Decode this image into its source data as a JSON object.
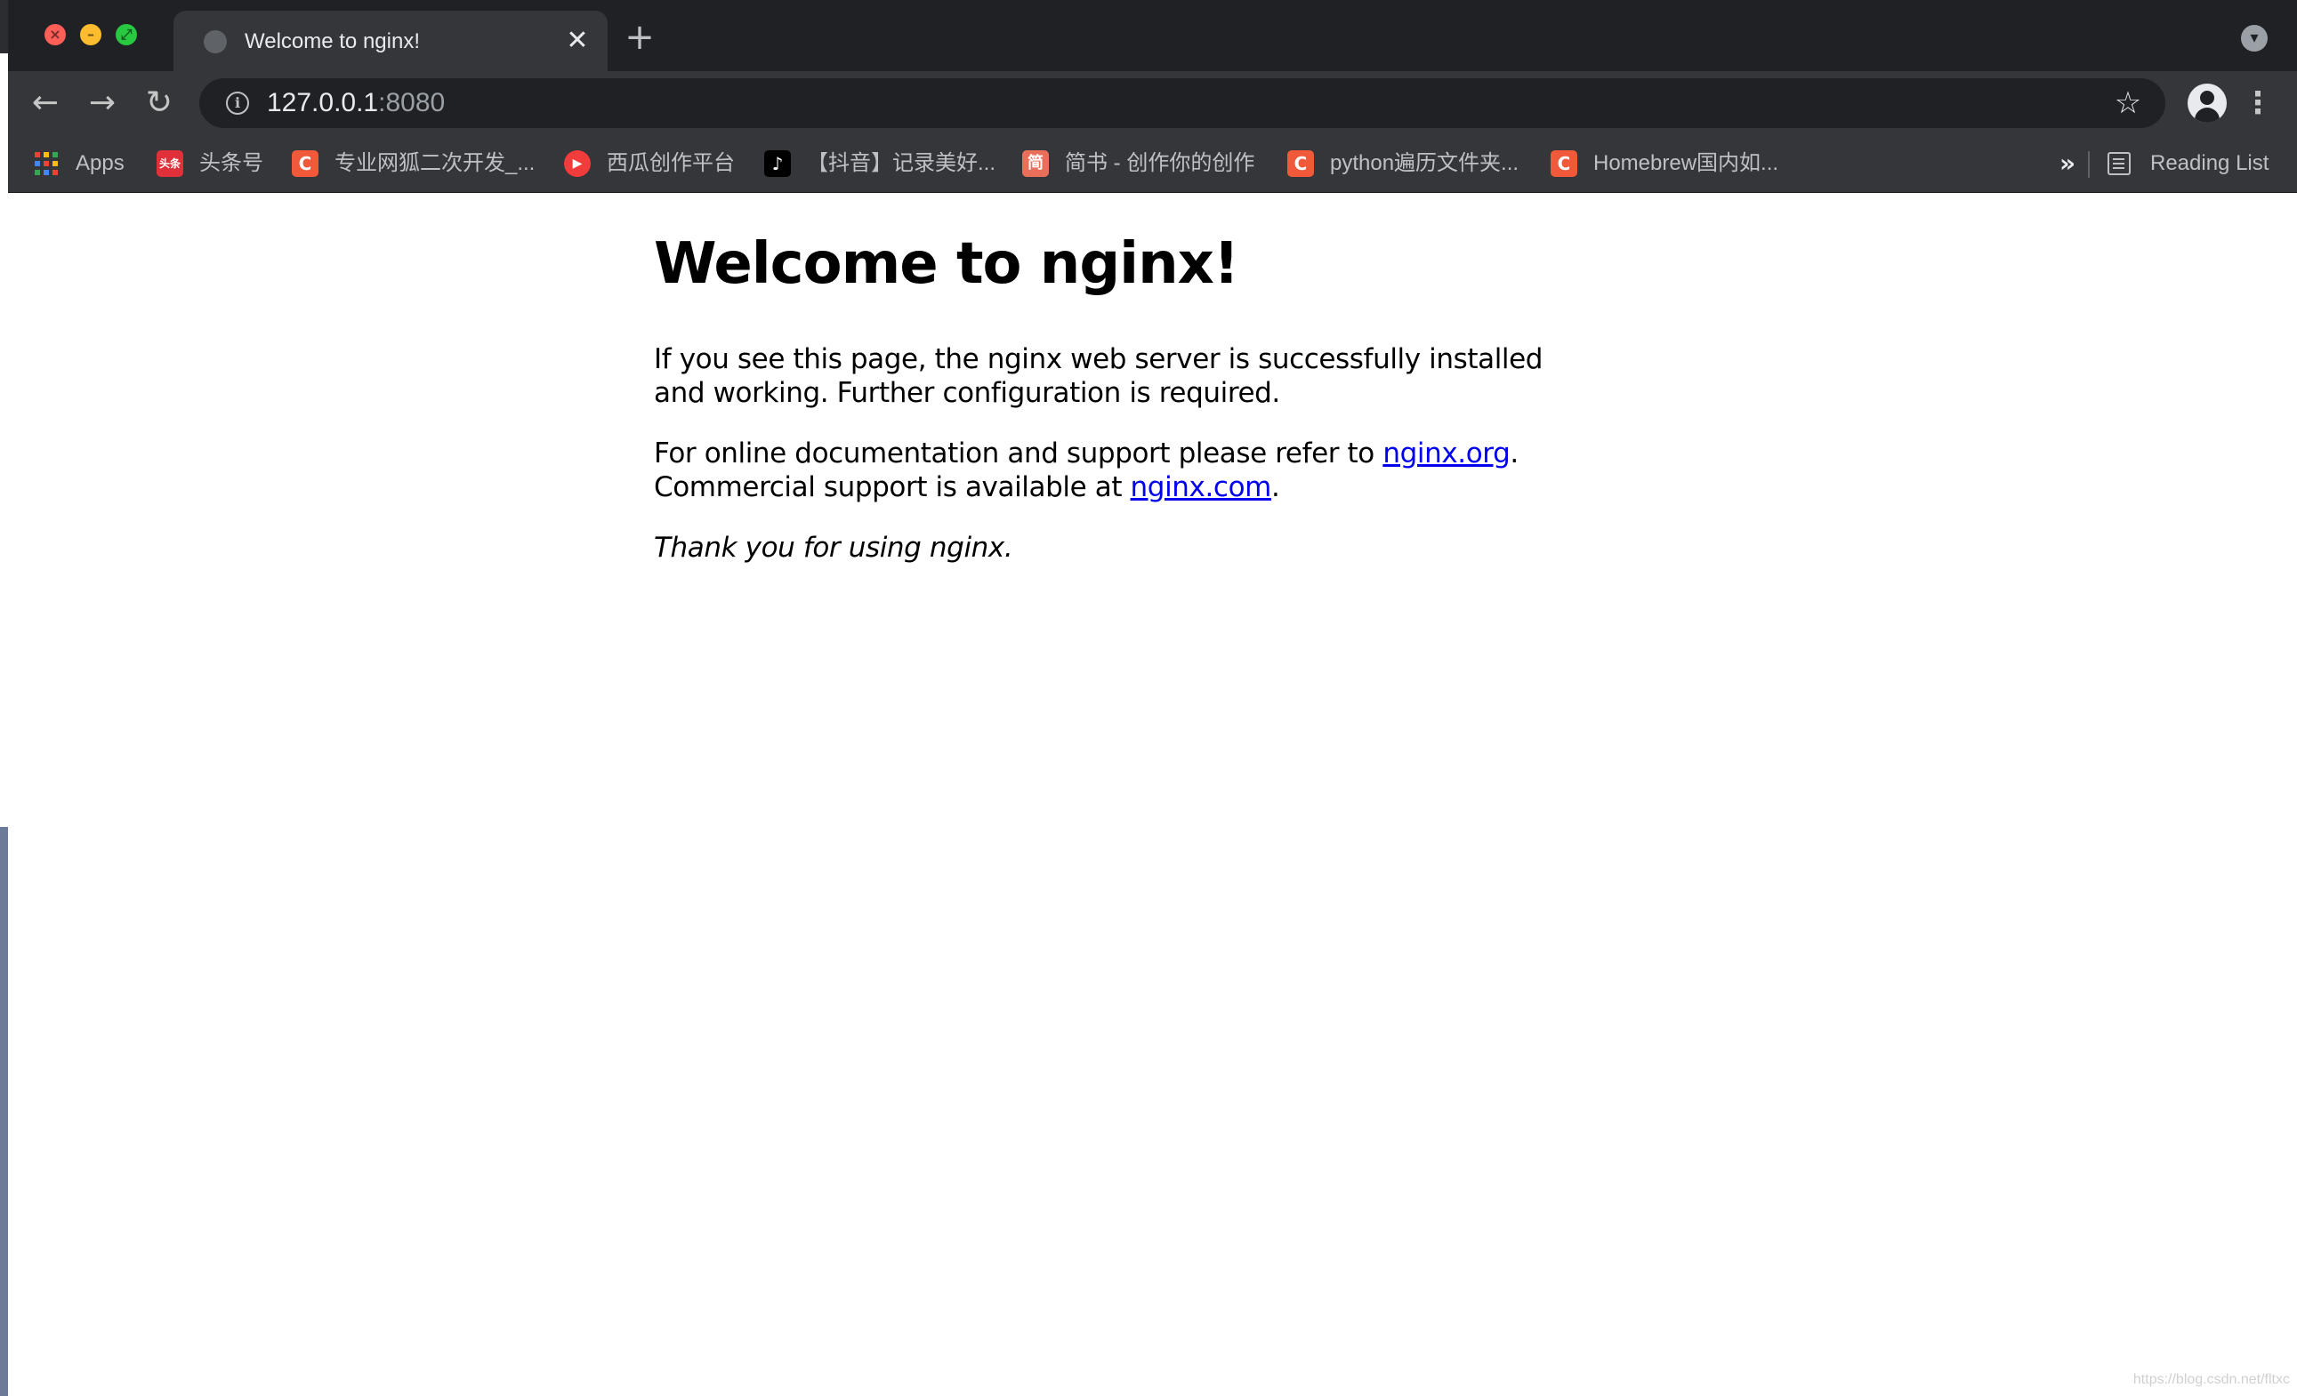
{
  "tab": {
    "title": "Welcome to nginx!",
    "close_glyph": "✕",
    "new_tab_glyph": "+"
  },
  "toolbar": {
    "back_glyph": "←",
    "forward_glyph": "→",
    "reload_glyph": "↻",
    "url_host": "127.0.0.1",
    "url_port": ":8080",
    "star_glyph": "☆",
    "menu_glyph": "⋮"
  },
  "bookmarks": {
    "items": [
      {
        "label": "Apps"
      },
      {
        "label": "头条号",
        "icon_text": "头条",
        "icon_color": "#e0313a"
      },
      {
        "label": "专业网狐二次开发_...",
        "icon_text": "C",
        "icon_color": "#f05a3b"
      },
      {
        "label": "西瓜创作平台",
        "icon_text": "▶",
        "icon_color": "#f23b3b"
      },
      {
        "label": "【抖音】记录美好...",
        "icon_text": "♪",
        "icon_color": "#000000"
      },
      {
        "label": "简书 - 创作你的创作",
        "icon_text": "简",
        "icon_color": "#ea6f5a"
      },
      {
        "label": "python遍历文件夹...",
        "icon_text": "C",
        "icon_color": "#f05a3b"
      },
      {
        "label": "Homebrew国内如...",
        "icon_text": "C",
        "icon_color": "#f05a3b"
      }
    ],
    "more_glyph": "»",
    "reading_list": "Reading List"
  },
  "page": {
    "heading": "Welcome to nginx!",
    "p1": "If you see this page, the nginx web server is successfully installed and working. Further configuration is required.",
    "p2_prefix": "For online documentation and support please refer to ",
    "link1": "nginx.org",
    "p2_mid": ".",
    "p2_line2": "Commercial support is available at ",
    "link2": "nginx.com",
    "p2_end": ".",
    "thanks": "Thank you for using nginx."
  },
  "watermark": "https://blog.csdn.net/fltxc"
}
